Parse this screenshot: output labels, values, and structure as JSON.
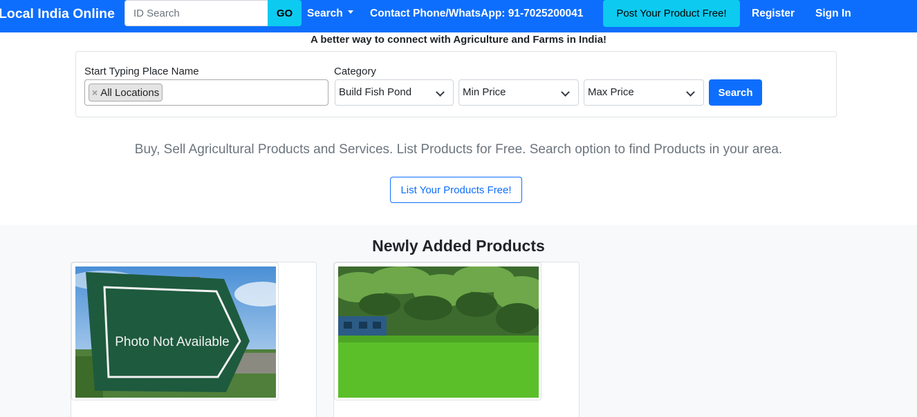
{
  "nav": {
    "brand": "Local India Online",
    "id_search_placeholder": "ID Search",
    "go_label": "GO",
    "search_label": "Search",
    "contact_label": "Contact Phone/WhatsApp: 91-7025200041",
    "post_label": "Post Your Product Free!",
    "register_label": "Register",
    "signin_label": "Sign In"
  },
  "tagline": "A better way to connect with Agriculture and Farms in India!",
  "search_panel": {
    "place_label": "Start Typing Place Name",
    "location_tag": "All Locations",
    "category_label": "Category",
    "category_value": "Build Fish Pond",
    "min_price": "Min Price",
    "max_price": "Max Price",
    "search_button": "Search"
  },
  "lead_text": "Buy, Sell Agricultural Products and Services. List Products for Free. Search option to find Products in your area.",
  "list_button": "List Your Products Free!",
  "products": {
    "heading": "Newly Added Products",
    "cards": [
      {
        "image": "photo-not-available",
        "image_text": "Photo Not Available"
      },
      {
        "image": "green-farm-land-with-palm-trees"
      }
    ]
  },
  "colors": {
    "primary": "#0d6efd",
    "info": "#0dcaf0",
    "muted": "#6c757d",
    "section_bg": "#f8f9fa"
  }
}
